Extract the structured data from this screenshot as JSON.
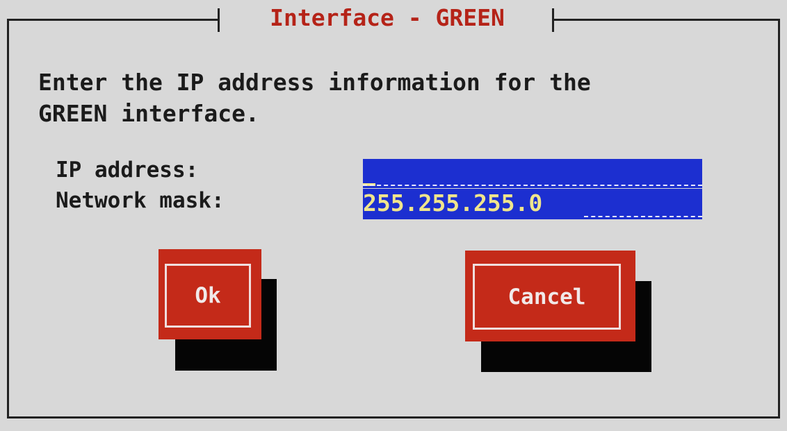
{
  "dialog": {
    "title": "Interface - GREEN",
    "prompt_line1": "Enter the IP address information for the",
    "prompt_line2": "GREEN interface."
  },
  "fields": {
    "ip_label": "IP address:",
    "ip_value": "",
    "mask_label": "Network mask:",
    "mask_value": "255.255.255.0"
  },
  "buttons": {
    "ok_label": "Ok",
    "cancel_label": "Cancel"
  },
  "colors": {
    "background": "#d8d8d8",
    "title_text": "#b52318",
    "field_background": "#1c2fd0",
    "field_text": "#f0e58c",
    "button": "#c42a19",
    "button_shadow": "#050505"
  }
}
